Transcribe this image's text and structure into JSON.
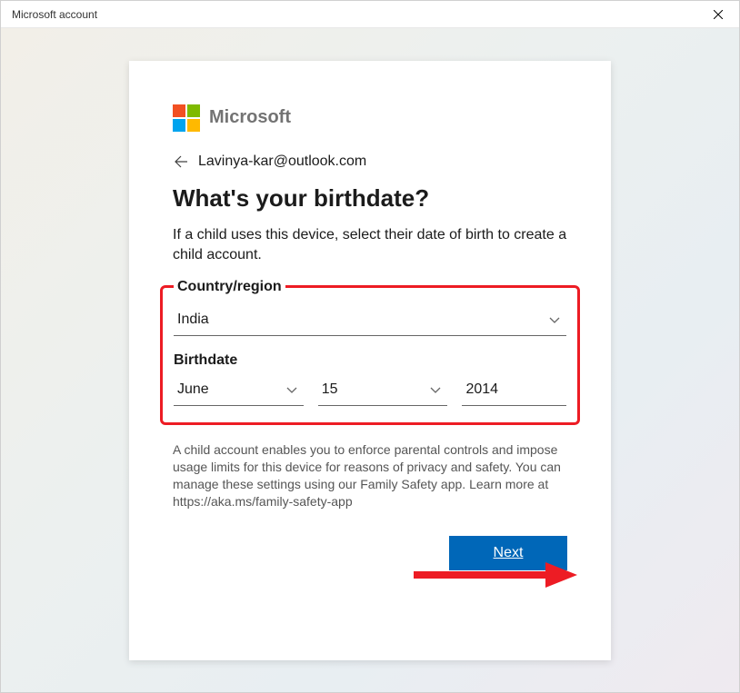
{
  "window": {
    "title": "Microsoft account"
  },
  "brand": {
    "name": "Microsoft"
  },
  "identity": {
    "email": "Lavinya-kar@outlook.com"
  },
  "heading": "What's your birthdate?",
  "subtext": "If a child uses this device, select their date of birth to create a child account.",
  "fields": {
    "country_label": "Country/region",
    "country_value": "India",
    "birthdate_label": "Birthdate",
    "month_value": "June",
    "day_value": "15",
    "year_value": "2014"
  },
  "disclaimer": "A child account enables you to enforce parental controls and impose usage limits for this device for reasons of privacy and safety. You can manage these settings using our Family Safety app. Learn more at https://aka.ms/family-safety-app",
  "actions": {
    "next_label": "Next"
  },
  "colors": {
    "accent": "#0067B8",
    "highlight": "#ED1C24"
  }
}
